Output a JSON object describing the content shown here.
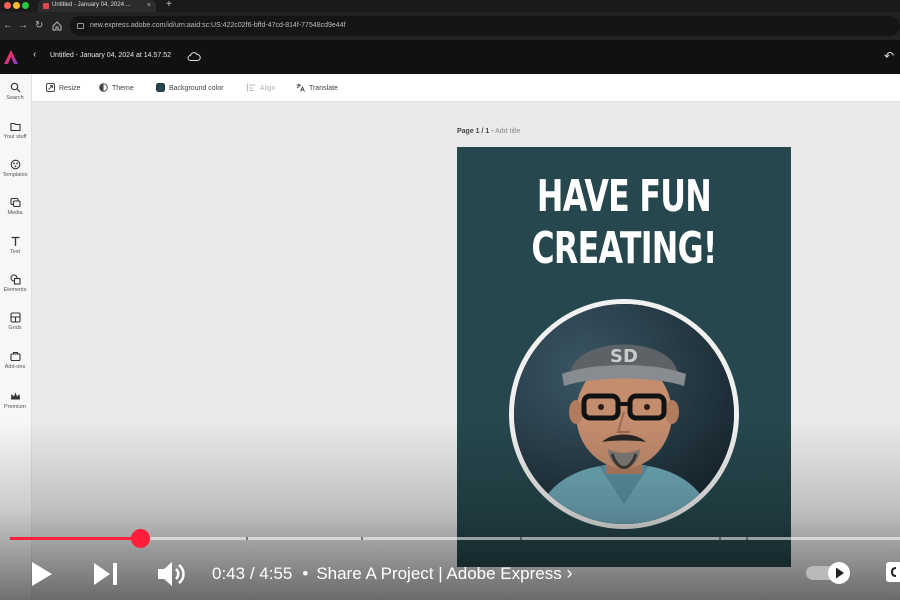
{
  "browser": {
    "tab_title": "Untitled - January 04, 2024 ...",
    "url": "new.express.adobe.com/id/urn:aaid:sc:US:422c02f6-bffd-47cd-814f-77548cd9e44f"
  },
  "app": {
    "document_title": "Untitled - January 04, 2024 at 14.57.52"
  },
  "toolbar": {
    "items": [
      {
        "label": "Resize",
        "icon": "resize-icon"
      },
      {
        "label": "Theme",
        "icon": "theme-icon"
      },
      {
        "label": "Background color",
        "icon": "color-swatch-icon"
      },
      {
        "label": "Align",
        "icon": "align-icon",
        "disabled": true
      },
      {
        "label": "Translate",
        "icon": "translate-icon"
      }
    ]
  },
  "sidebar": {
    "items": [
      {
        "label": "Search",
        "icon": "search-icon"
      },
      {
        "label": "Your stuff",
        "icon": "folder-icon"
      },
      {
        "label": "Templates",
        "icon": "templates-icon"
      },
      {
        "label": "Media",
        "icon": "media-icon"
      },
      {
        "label": "Text",
        "icon": "text-icon"
      },
      {
        "label": "Elements",
        "icon": "elements-icon"
      },
      {
        "label": "Grids",
        "icon": "grids-icon"
      },
      {
        "label": "Add-ons",
        "icon": "addons-icon"
      },
      {
        "label": "Premium",
        "icon": "premium-icon"
      }
    ]
  },
  "canvas": {
    "page_label": "Page 1 / 1",
    "page_separator": " - ",
    "add_title": "Add title",
    "headline_line1": "HAVE FUN",
    "headline_line2": "CREATING!",
    "background_color": "#26474d"
  },
  "video": {
    "current_time": "0:43",
    "duration": "4:55",
    "time_separator": " / ",
    "title": "Share A Project | Adobe Express",
    "progress_fraction": 0.146,
    "chapter_markers": [
      0.155,
      0.265,
      0.394,
      0.573,
      0.797,
      0.827
    ],
    "progress_color": "#ff1f3d"
  }
}
